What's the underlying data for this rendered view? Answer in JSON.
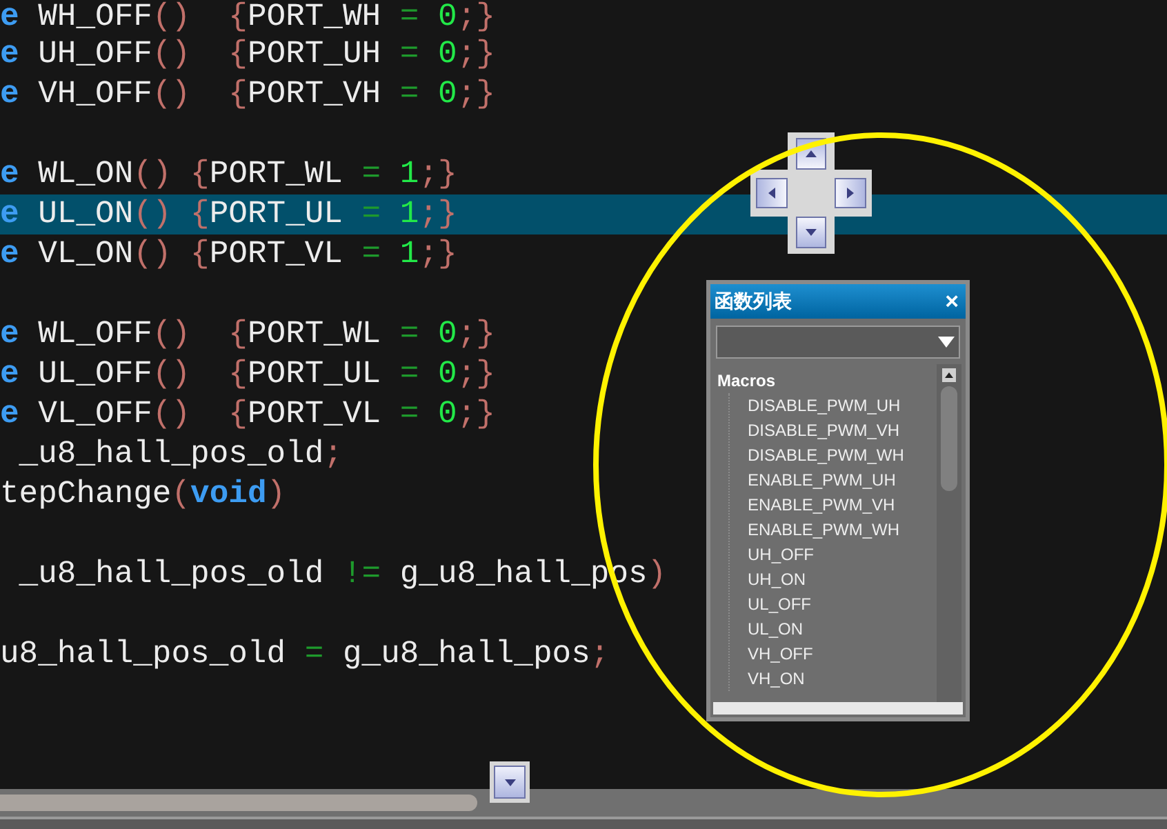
{
  "code_lines": [
    {
      "kind": "code",
      "selected": false,
      "tokens": [
        {
          "kind": "keyword",
          "text": "e"
        },
        {
          "kind": "ident",
          "text": " WH_OFF"
        },
        {
          "kind": "punct",
          "text": "()"
        },
        {
          "kind": "punct",
          "text": "  {"
        },
        {
          "kind": "ident",
          "text": "PORT_WH "
        },
        {
          "kind": "op",
          "text": "="
        },
        {
          "kind": "number",
          "text": " 0"
        },
        {
          "kind": "punct",
          "text": ";}"
        }
      ]
    },
    {
      "kind": "code",
      "selected": false,
      "tokens": [
        {
          "kind": "keyword",
          "text": "e"
        },
        {
          "kind": "ident",
          "text": " UH_OFF"
        },
        {
          "kind": "punct",
          "text": "()"
        },
        {
          "kind": "punct",
          "text": "  {"
        },
        {
          "kind": "ident",
          "text": "PORT_UH "
        },
        {
          "kind": "op",
          "text": "="
        },
        {
          "kind": "number",
          "text": " 0"
        },
        {
          "kind": "punct",
          "text": ";}"
        }
      ]
    },
    {
      "kind": "code",
      "selected": false,
      "tokens": [
        {
          "kind": "keyword",
          "text": "e"
        },
        {
          "kind": "ident",
          "text": " VH_OFF"
        },
        {
          "kind": "punct",
          "text": "()"
        },
        {
          "kind": "punct",
          "text": "  {"
        },
        {
          "kind": "ident",
          "text": "PORT_VH "
        },
        {
          "kind": "op",
          "text": "="
        },
        {
          "kind": "number",
          "text": " 0"
        },
        {
          "kind": "punct",
          "text": ";}"
        }
      ]
    },
    {
      "kind": "blank",
      "selected": false
    },
    {
      "kind": "code",
      "selected": false,
      "tokens": [
        {
          "kind": "keyword",
          "text": "e"
        },
        {
          "kind": "ident",
          "text": " WL_ON"
        },
        {
          "kind": "punct",
          "text": "() {"
        },
        {
          "kind": "ident",
          "text": "PORT_WL "
        },
        {
          "kind": "op",
          "text": "="
        },
        {
          "kind": "number",
          "text": " 1"
        },
        {
          "kind": "punct",
          "text": ";}"
        }
      ]
    },
    {
      "kind": "code",
      "selected": true,
      "tokens": [
        {
          "kind": "keyword",
          "text": "e"
        },
        {
          "kind": "ident",
          "text": " UL_ON"
        },
        {
          "kind": "punct",
          "text": "() {"
        },
        {
          "kind": "ident",
          "text": "PORT_UL "
        },
        {
          "kind": "op",
          "text": "="
        },
        {
          "kind": "number",
          "text": " 1"
        },
        {
          "kind": "punct",
          "text": ";}"
        }
      ]
    },
    {
      "kind": "code",
      "selected": false,
      "tokens": [
        {
          "kind": "keyword",
          "text": "e"
        },
        {
          "kind": "ident",
          "text": " VL_ON"
        },
        {
          "kind": "punct",
          "text": "() {"
        },
        {
          "kind": "ident",
          "text": "PORT_VL "
        },
        {
          "kind": "op",
          "text": "="
        },
        {
          "kind": "number",
          "text": " 1"
        },
        {
          "kind": "punct",
          "text": ";}"
        }
      ]
    },
    {
      "kind": "blank",
      "selected": false
    },
    {
      "kind": "code",
      "selected": false,
      "tokens": [
        {
          "kind": "keyword",
          "text": "e"
        },
        {
          "kind": "ident",
          "text": " WL_OFF"
        },
        {
          "kind": "punct",
          "text": "()"
        },
        {
          "kind": "punct",
          "text": "  {"
        },
        {
          "kind": "ident",
          "text": "PORT_WL "
        },
        {
          "kind": "op",
          "text": "="
        },
        {
          "kind": "number",
          "text": " 0"
        },
        {
          "kind": "punct",
          "text": ";}"
        }
      ]
    },
    {
      "kind": "code",
      "selected": false,
      "tokens": [
        {
          "kind": "keyword",
          "text": "e"
        },
        {
          "kind": "ident",
          "text": " UL_OFF"
        },
        {
          "kind": "punct",
          "text": "()"
        },
        {
          "kind": "punct",
          "text": "  {"
        },
        {
          "kind": "ident",
          "text": "PORT_UL "
        },
        {
          "kind": "op",
          "text": "="
        },
        {
          "kind": "number",
          "text": " 0"
        },
        {
          "kind": "punct",
          "text": ";}"
        }
      ]
    },
    {
      "kind": "code",
      "selected": false,
      "tokens": [
        {
          "kind": "keyword",
          "text": "e"
        },
        {
          "kind": "ident",
          "text": " VL_OFF"
        },
        {
          "kind": "punct",
          "text": "()"
        },
        {
          "kind": "punct",
          "text": "  {"
        },
        {
          "kind": "ident",
          "text": "PORT_VL "
        },
        {
          "kind": "op",
          "text": "="
        },
        {
          "kind": "number",
          "text": " 0"
        },
        {
          "kind": "punct",
          "text": ";}"
        }
      ]
    },
    {
      "kind": "code",
      "selected": false,
      "tokens": [
        {
          "kind": "ident",
          "text": " _u8_hall_pos_old"
        },
        {
          "kind": "punct",
          "text": ";"
        }
      ]
    },
    {
      "kind": "code",
      "selected": false,
      "tokens": [
        {
          "kind": "ident",
          "text": "tepChange"
        },
        {
          "kind": "punct",
          "text": "("
        },
        {
          "kind": "keyword",
          "text": "void"
        },
        {
          "kind": "punct",
          "text": ")"
        }
      ]
    },
    {
      "kind": "blank",
      "selected": false
    },
    {
      "kind": "code",
      "selected": false,
      "tokens": [
        {
          "kind": "ident",
          "text": " _u8_hall_pos_old "
        },
        {
          "kind": "op",
          "text": "!="
        },
        {
          "kind": "ident",
          "text": " g_u8_hall_pos"
        },
        {
          "kind": "punct",
          "text": ")"
        }
      ]
    },
    {
      "kind": "blank",
      "selected": false
    },
    {
      "kind": "code",
      "selected": false,
      "tokens": [
        {
          "kind": "ident",
          "text": "u8_hall_pos_old "
        },
        {
          "kind": "op",
          "text": "="
        },
        {
          "kind": "ident",
          "text": " g_u8_hall_pos"
        },
        {
          "kind": "punct",
          "text": ";"
        }
      ]
    }
  ],
  "function_list_panel": {
    "title": "函数列表",
    "close": "×",
    "groups": [
      {
        "label": "Macros",
        "children": [
          {
            "label": "DISABLE_PWM_UH"
          },
          {
            "label": "DISABLE_PWM_VH"
          },
          {
            "label": "DISABLE_PWM_WH"
          },
          {
            "label": "ENABLE_PWM_UH"
          },
          {
            "label": "ENABLE_PWM_VH"
          },
          {
            "label": "ENABLE_PWM_WH"
          },
          {
            "label": "UH_OFF"
          },
          {
            "label": "UH_ON"
          },
          {
            "label": "UL_OFF"
          },
          {
            "label": "UL_ON"
          },
          {
            "label": "VH_OFF"
          },
          {
            "label": "VH_ON"
          }
        ]
      }
    ]
  }
}
